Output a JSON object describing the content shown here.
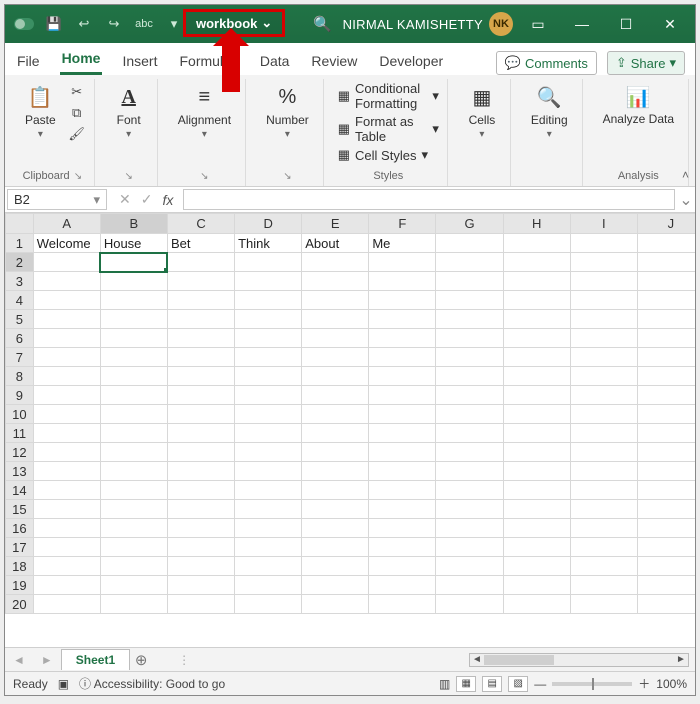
{
  "titlebar": {
    "workbook_name": "workbook",
    "user_name": "NIRMAL KAMISHETTY",
    "avatar_initials": "NK"
  },
  "tabs": {
    "file": "File",
    "home": "Home",
    "insert": "Insert",
    "formulas": "Formulas",
    "data": "Data",
    "review": "Review",
    "developer": "Developer",
    "comments": "Comments",
    "share": "Share"
  },
  "ribbon": {
    "clipboard": {
      "paste": "Paste",
      "label": "Clipboard"
    },
    "font": {
      "btn": "Font"
    },
    "alignment": {
      "btn": "Alignment"
    },
    "number": {
      "btn": "Number"
    },
    "styles": {
      "cond": "Conditional Formatting",
      "table": "Format as Table",
      "cell": "Cell Styles",
      "label": "Styles"
    },
    "cells": {
      "btn": "Cells"
    },
    "editing": {
      "btn": "Editing"
    },
    "analysis": {
      "btn": "Analyze Data",
      "label": "Analysis"
    }
  },
  "namebox": {
    "ref": "B2"
  },
  "columns": [
    "A",
    "B",
    "C",
    "D",
    "E",
    "F",
    "G",
    "H",
    "I",
    "J"
  ],
  "rows": [
    "1",
    "2",
    "3",
    "4",
    "5",
    "6",
    "7",
    "8",
    "9",
    "10",
    "11",
    "12",
    "13",
    "14",
    "15",
    "16",
    "17",
    "18",
    "19",
    "20"
  ],
  "cells": {
    "A1": "Welcome",
    "B1": "House",
    "C1": "Bet",
    "D1": "Think",
    "E1": "About",
    "F1": "Me"
  },
  "selected_cell": "B2",
  "sheet": {
    "name": "Sheet1"
  },
  "status": {
    "ready": "Ready",
    "accessibility": "Accessibility: Good to go",
    "zoom": "100%"
  }
}
